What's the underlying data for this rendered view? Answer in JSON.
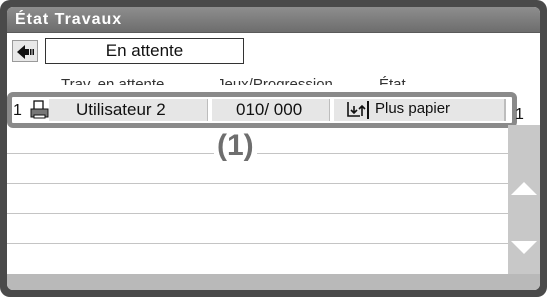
{
  "window": {
    "title": "État Travaux"
  },
  "toolbar": {
    "back_icon": "back-arrow-icon",
    "tab_label": "En attente"
  },
  "columns": [
    "Trav. en attente",
    "Jeux/Progression",
    "État"
  ],
  "job": {
    "index": "1",
    "icon": "print-job-icon",
    "user": "Utilisateur 2",
    "sets": "010/ 000",
    "status_icon": "add-paper-icon",
    "status": "Plus papier"
  },
  "callout": "(1)",
  "pager": {
    "total": "1",
    "current": "1"
  },
  "colors": {
    "frame": "#4a4a4a",
    "titlebar": "#7a7a7a",
    "scrollbar": "#c8c8c8",
    "callout": "#6e6e6e"
  }
}
